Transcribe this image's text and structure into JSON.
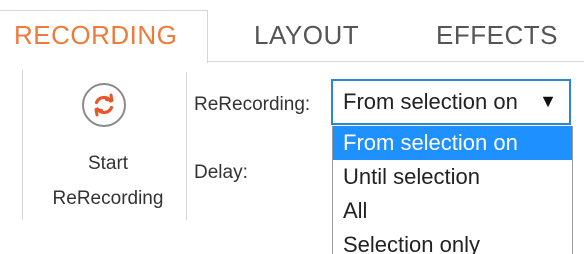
{
  "tabs": [
    {
      "label": "RECORDING",
      "active": true
    },
    {
      "label": "LAYOUT",
      "active": false
    },
    {
      "label": "EFFECTS",
      "active": false
    }
  ],
  "colors": {
    "accent": "#f07a3a",
    "selection": "#1e90ff",
    "focus_border": "#2a86d8"
  },
  "rerecord_button": {
    "line1": "Start",
    "line2": "ReRecording",
    "icon": "refresh-icon"
  },
  "fields": {
    "rerecording_label": "ReRecording:",
    "rerecording_value": "From selection on",
    "delay_label": "Delay:"
  },
  "dropdown": {
    "options": [
      "From selection on",
      "Until selection",
      "All",
      "Selection only"
    ],
    "selected": "From selection on"
  }
}
